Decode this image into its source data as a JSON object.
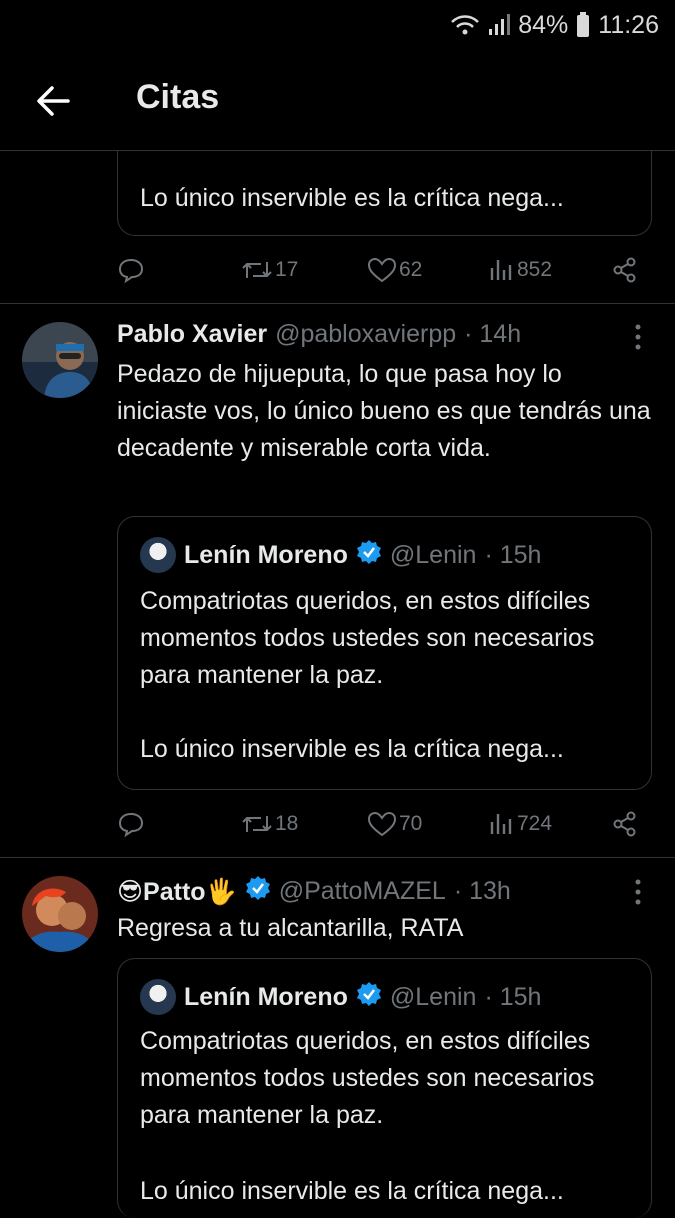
{
  "status_bar": {
    "battery": "84%",
    "time": "11:26"
  },
  "header": {
    "title": "Citas"
  },
  "top_partial": {
    "quote_text": "Lo único inservible es la crítica nega...",
    "actions": {
      "retweets": "17",
      "likes": "62",
      "views": "852"
    }
  },
  "tweet1": {
    "name": "Pablo Xavier",
    "handle": "@pabloxavierpp",
    "time": "· 14h",
    "text": "Pedazo de hijueputa, lo que pasa hoy lo iniciaste vos, lo único bueno es que tendrás una decadente y miserable corta vida.",
    "quote": {
      "name": "Lenín Moreno",
      "handle": "@Lenin",
      "time": "· 15h",
      "text": "Compatriotas queridos, en estos difíciles momentos todos ustedes son necesarios para mantener la paz.",
      "text2": "Lo único inservible es la crítica nega..."
    },
    "actions": {
      "retweets": "18",
      "likes": "70",
      "views": "724"
    }
  },
  "tweet2": {
    "name": "😎Patto🖐",
    "handle": "@PattoMAZEL",
    "time": "· 13h",
    "text": "Regresa a tu alcantarilla, RATA",
    "quote": {
      "name": "Lenín Moreno",
      "handle": "@Lenin",
      "time": "· 15h",
      "text": "Compatriotas queridos, en estos difíciles momentos todos ustedes son necesarios para mantener la paz.",
      "text2": "Lo único inservible es la crítica nega..."
    }
  },
  "colors": {
    "background": "#000000",
    "text": "#e7e9ea",
    "muted": "#71767b",
    "verified": "#1d9bf0",
    "border": "#2f3336"
  }
}
